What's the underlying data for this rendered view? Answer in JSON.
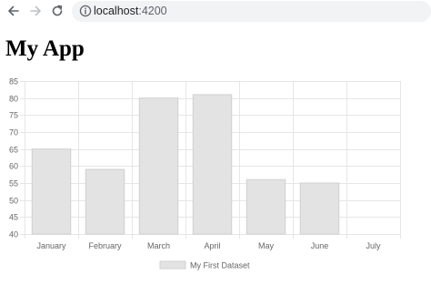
{
  "browser": {
    "url_host": "localhost",
    "url_port": ":4200",
    "icons": [
      "back-arrow-icon",
      "forward-arrow-icon",
      "reload-icon",
      "info-icon"
    ]
  },
  "page": {
    "title": "My App"
  },
  "chart_data": {
    "type": "bar",
    "categories": [
      "January",
      "February",
      "March",
      "April",
      "May",
      "June",
      "July"
    ],
    "series": [
      {
        "name": "My First Dataset",
        "values": [
          65,
          59,
          80,
          81,
          56,
          55,
          40
        ]
      }
    ],
    "ylim": [
      40,
      85
    ],
    "yticks": [
      40,
      45,
      50,
      55,
      60,
      65,
      70,
      75,
      80,
      85
    ],
    "grid": true,
    "legend": "bottom",
    "bar_color": "#e3e3e3",
    "bar_border_color": "#d0d0d0",
    "grid_color": "#e6e6e6"
  }
}
